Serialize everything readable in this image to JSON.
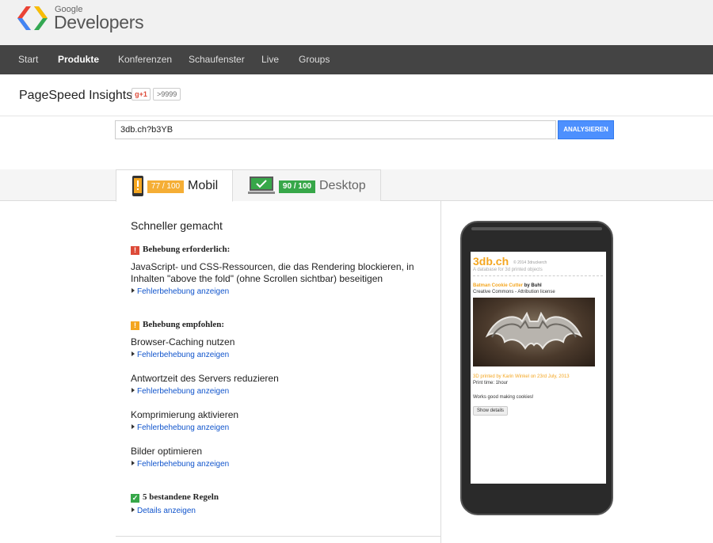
{
  "header": {
    "brand_small": "Google",
    "brand_big": "Developers"
  },
  "nav": {
    "items": [
      {
        "label": "Start"
      },
      {
        "label": "Produkte"
      },
      {
        "label": "Konferenzen"
      },
      {
        "label": "Schaufenster"
      },
      {
        "label": "Live"
      },
      {
        "label": "Groups"
      }
    ]
  },
  "product": {
    "title": "PageSpeed Insights",
    "gplus_label": "+1",
    "gplus_count": ">9999"
  },
  "form": {
    "url_value": "3db.ch?b3YB",
    "analyze_label": "ANALYSIEREN"
  },
  "tabs": [
    {
      "label": "Mobil",
      "score": "77 / 100"
    },
    {
      "label": "Desktop",
      "score": "90 / 100"
    }
  ],
  "results": {
    "heading": "Schneller gemacht",
    "required": {
      "title": "Behebung erforderlich:",
      "rules": [
        {
          "text": "JavaScript- und CSS-Ressourcen, die das Rendering blockieren, in Inhalten \"above the fold\" (ohne Scrollen sichtbar) beseitigen",
          "link": "Fehlerbehebung anzeigen"
        }
      ]
    },
    "recommended": {
      "title": "Behebung empfohlen:",
      "rules": [
        {
          "text": "Browser-Caching nutzen",
          "link": "Fehlerbehebung anzeigen"
        },
        {
          "text": "Antwortzeit des Servers reduzieren",
          "link": "Fehlerbehebung anzeigen"
        },
        {
          "text": "Komprimierung aktivieren",
          "link": "Fehlerbehebung anzeigen"
        },
        {
          "text": "Bilder optimieren",
          "link": "Fehlerbehebung anzeigen"
        }
      ]
    },
    "passed": {
      "title": "5 bestandene Regeln",
      "link": "Details anzeigen"
    }
  },
  "preview": {
    "site_logo": "3db.ch",
    "site_year": "© 2014 3druckerch",
    "site_tagline": "A database for 3d printed objects",
    "item_title": "Batman Cookie Cutter",
    "item_by": "by Buhl",
    "item_license": "Creative Commons - Attribution license",
    "printed_by": "3D printed by Karin Winkel on 23rd July, 2013",
    "print_time": "Print time: 1hour",
    "comment": "Works good making cookies!",
    "button": "Show details"
  },
  "colors": {
    "score_mobile": "#f4a620",
    "score_desktop": "#37a749",
    "link": "#1155cc",
    "nav_bg": "#444444"
  }
}
